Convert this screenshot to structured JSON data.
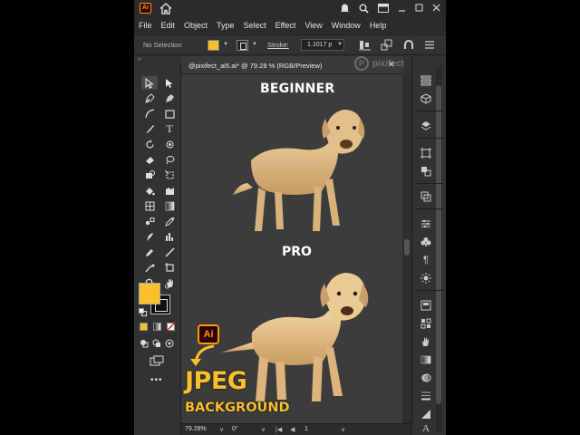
{
  "app": {
    "logo": "Ai",
    "icons": [
      "home-icon",
      "bell-icon",
      "search-icon",
      "arrange-documents-icon",
      "minimize-icon",
      "maximize-icon",
      "close-icon"
    ]
  },
  "menu": {
    "items": [
      "File",
      "Edit",
      "Object",
      "Type",
      "Select",
      "Effect",
      "View",
      "Window",
      "Help"
    ]
  },
  "control_bar": {
    "selection_status": "No Selection",
    "fill_color": "#fbbf2b",
    "stroke_label": "Stroke:",
    "stroke_value": "1.1017 p"
  },
  "document": {
    "tab_title": "@pixifect_ai5.ai* @ 79.28 % (RGB/Preview)",
    "watermark": "pixifect"
  },
  "artboard": {
    "label_top": "BEGINNER",
    "label_bottom": "PRO",
    "badge": "Ai",
    "headline": "JPEG",
    "subheadline": "BACKGROUND"
  },
  "status_bar": {
    "zoom": "79.28%",
    "rotation": "0°",
    "page": "1"
  },
  "colors": {
    "accent_yellow": "#fbbf2b",
    "ai_orange": "#ff9a00",
    "panel_bg": "#323232",
    "canvas_bg": "#3c3c3c"
  }
}
